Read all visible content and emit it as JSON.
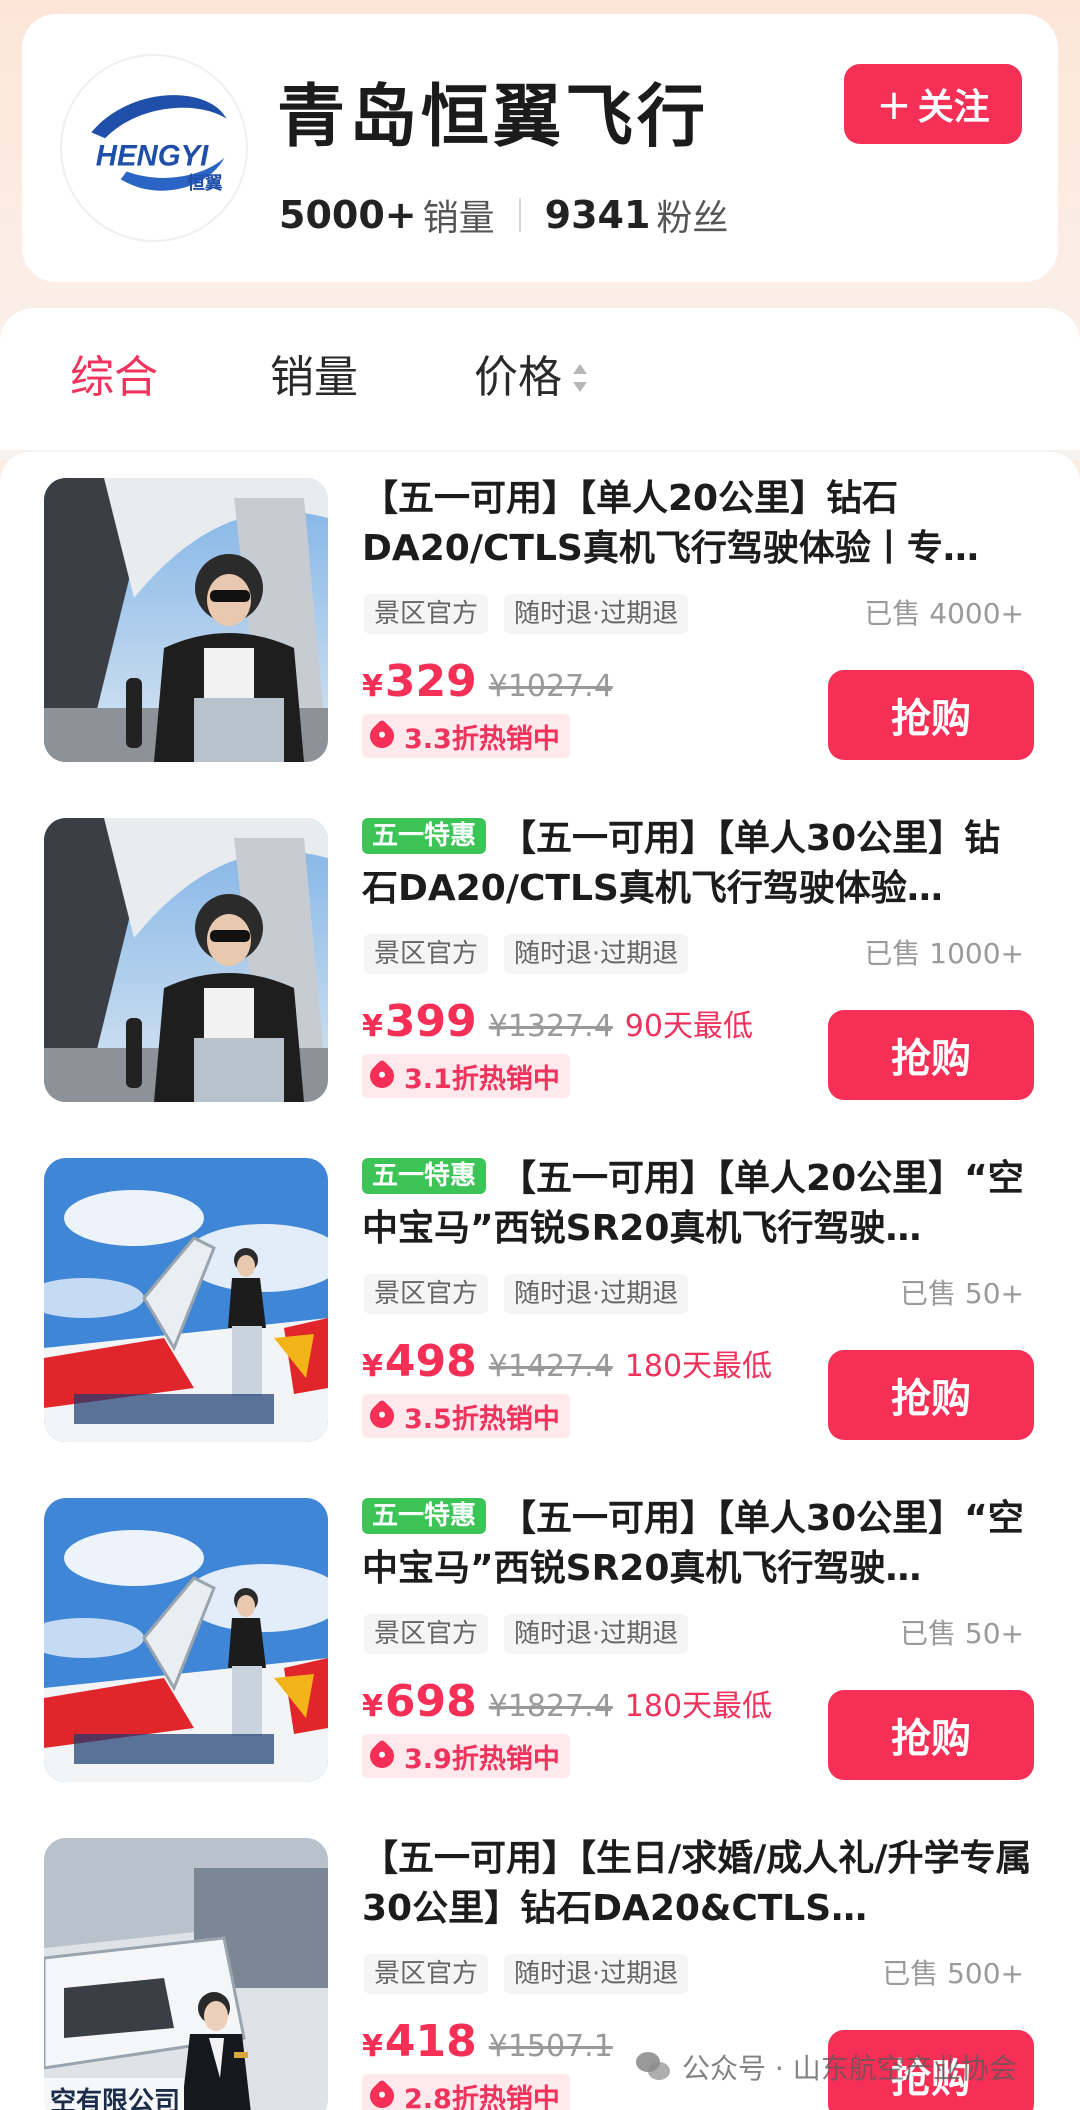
{
  "shop": {
    "name": "青岛恒翼飞行",
    "logo_text": "HENGYI",
    "logo_cn": "恒翼",
    "sales_value": "5000+",
    "sales_label": "销量",
    "fans_value": "9341",
    "fans_label": "粉丝",
    "follow_icon": "plus-icon",
    "follow_label": "关注"
  },
  "sort": {
    "tabs": [
      {
        "label": "综合",
        "active": true
      },
      {
        "label": "销量",
        "active": false
      },
      {
        "label": "价格",
        "active": false
      }
    ]
  },
  "products": [
    {
      "promo": "",
      "title": "【五一可用】【单人20公里】钻石DA20/CTLS真机飞行驾驶体验丨专…",
      "tags": [
        "景区官方",
        "随时退·过期退"
      ],
      "sold": "已售 4000+",
      "price": "329",
      "original_price": "¥1027.4",
      "lowest": "",
      "discount": "3.3折热销中",
      "buy_label": "抢购",
      "image": "cockpit-pilot-photo"
    },
    {
      "promo": "五一特惠",
      "title": "【五一可用】【单人30公里】钻石DA20/CTLS真机飞行驾驶体验…",
      "tags": [
        "景区官方",
        "随时退·过期退"
      ],
      "sold": "已售 1000+",
      "price": "399",
      "original_price": "¥1327.4",
      "lowest": "90天最低",
      "discount": "3.1折热销中",
      "buy_label": "抢购",
      "image": "cockpit-pilot-photo"
    },
    {
      "promo": "五一特惠",
      "title": "【五一可用】【单人20公里】“空中宝马”西锐SR20真机飞行驾驶…",
      "tags": [
        "景区官方",
        "随时退·过期退"
      ],
      "sold": "已售 50+",
      "price": "498",
      "original_price": "¥1427.4",
      "lowest": "180天最低",
      "discount": "3.5折热销中",
      "buy_label": "抢购",
      "image": "plane-wing-photo"
    },
    {
      "promo": "五一特惠",
      "title": "【五一可用】【单人30公里】“空中宝马”西锐SR20真机飞行驾驶…",
      "tags": [
        "景区官方",
        "随时退·过期退"
      ],
      "sold": "已售 50+",
      "price": "698",
      "original_price": "¥1827.4",
      "lowest": "180天最低",
      "discount": "3.9折热销中",
      "buy_label": "抢购",
      "image": "plane-wing-photo"
    },
    {
      "promo": "",
      "title": "【五一可用】【生日/求婚/成人礼/升学专属30公里】钻石DA20&CTLS…",
      "tags": [
        "景区官方",
        "随时退·过期退"
      ],
      "sold": "已售 500+",
      "price": "418",
      "original_price": "¥1507.1",
      "lowest": "",
      "discount": "2.8折热销中",
      "buy_label": "抢购",
      "image": "hangar-pilot-photo",
      "image_text": "空有限公司"
    }
  ],
  "watermark": "公众号 · 山东航空产业协会",
  "colors": {
    "accent": "#f52f56",
    "promo_green": "#3cc457",
    "logo_blue": "#1f4fa8"
  }
}
